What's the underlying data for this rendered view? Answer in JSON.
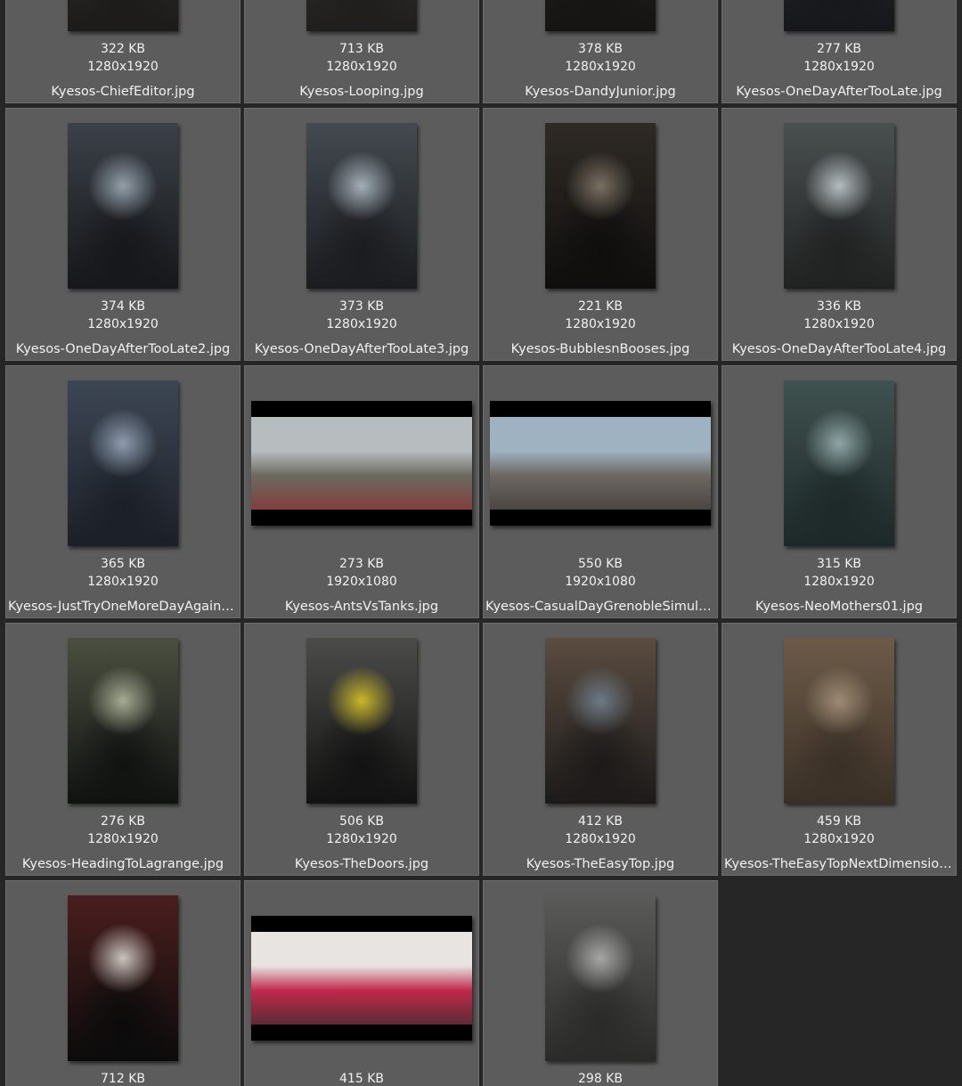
{
  "items": [
    {
      "size": "322 KB",
      "dims": "1280x1920",
      "name": "Kyesos-ChiefEditor.jpg",
      "orientation": "portrait",
      "colors": [
        "#9a9590",
        "#3a3835",
        "#1c1b1a"
      ]
    },
    {
      "size": "713 KB",
      "dims": "1280x1920",
      "name": "Kyesos-Looping.jpg",
      "orientation": "portrait",
      "colors": [
        "#8e8983",
        "#3f3d3a",
        "#1f1e1d"
      ]
    },
    {
      "size": "378 KB",
      "dims": "1280x1920",
      "name": "Kyesos-DandyJunior.jpg",
      "orientation": "portrait",
      "colors": [
        "#6e665d",
        "#2e2a26",
        "#151413"
      ]
    },
    {
      "size": "277 KB",
      "dims": "1280x1920",
      "name": "Kyesos-OneDayAfterTooLate.jpg",
      "orientation": "portrait",
      "colors": [
        "#6b7078",
        "#2a2d33",
        "#16181b"
      ]
    },
    {
      "size": "374 KB",
      "dims": "1280x1920",
      "name": "Kyesos-OneDayAfterTooLate2.jpg",
      "orientation": "portrait",
      "colors": [
        "#93a0aa",
        "#3b4148",
        "#15171a"
      ]
    },
    {
      "size": "373 KB",
      "dims": "1280x1920",
      "name": "Kyesos-OneDayAfterTooLate3.jpg",
      "orientation": "portrait",
      "colors": [
        "#a3aeb6",
        "#444a50",
        "#1a1c1f"
      ]
    },
    {
      "size": "221 KB",
      "dims": "1280x1920",
      "name": "Kyesos-BubblesnBooses.jpg",
      "orientation": "portrait",
      "colors": [
        "#7a6f62",
        "#2f2a25",
        "#0f0e0d"
      ]
    },
    {
      "size": "336 KB",
      "dims": "1280x1920",
      "name": "Kyesos-OneDayAfterTooLate4.jpg",
      "orientation": "portrait",
      "colors": [
        "#b4bcc0",
        "#4a4f50",
        "#1f2221"
      ]
    },
    {
      "size": "365 KB",
      "dims": "1280x1920",
      "name": "Kyesos-JustTryOneMoreDayAgain.jpg",
      "orientation": "portrait",
      "colors": [
        "#8e9cae",
        "#3d4654",
        "#1b1f27"
      ]
    },
    {
      "size": "273 KB",
      "dims": "1920x1080",
      "name": "Kyesos-AntsVsTanks.jpg",
      "orientation": "landscape",
      "colors": [
        "#b7bdbf",
        "#6b6a5f",
        "#8c2a2e"
      ]
    },
    {
      "size": "550 KB",
      "dims": "1920x1080",
      "name": "Kyesos-CasualDayGrenobleSimulation.jpg",
      "orientation": "landscape",
      "colors": [
        "#9fb2c2",
        "#6c6761",
        "#3a3634"
      ]
    },
    {
      "size": "315 KB",
      "dims": "1280x1920",
      "name": "Kyesos-NeoMothers01.jpg",
      "orientation": "portrait",
      "colors": [
        "#8fa6a6",
        "#3f5150",
        "#1d2828"
      ]
    },
    {
      "size": "276 KB",
      "dims": "1280x1920",
      "name": "Kyesos-HeadingToLagrange.jpg",
      "orientation": "portrait",
      "colors": [
        "#a4aa92",
        "#4a4f40",
        "#101210"
      ]
    },
    {
      "size": "506 KB",
      "dims": "1280x1920",
      "name": "Kyesos-TheDoors.jpg",
      "orientation": "portrait",
      "colors": [
        "#c9b72a",
        "#4b4b48",
        "#121212"
      ]
    },
    {
      "size": "412 KB",
      "dims": "1280x1920",
      "name": "Kyesos-TheEasyTop.jpg",
      "orientation": "portrait",
      "colors": [
        "#6b7a86",
        "#5a4c40",
        "#1c1a19"
      ]
    },
    {
      "size": "459 KB",
      "dims": "1280x1920",
      "name": "Kyesos-TheEasyTopNextDimension.jpg",
      "orientation": "portrait",
      "colors": [
        "#9c8a74",
        "#6d5b48",
        "#3a3026"
      ]
    },
    {
      "size": "712 KB",
      "dims": "",
      "name": "",
      "orientation": "portrait",
      "colors": [
        "#c9c3bd",
        "#4a1e1e",
        "#0b0b0b"
      ]
    },
    {
      "size": "415 KB",
      "dims": "",
      "name": "",
      "orientation": "landscape",
      "colors": [
        "#e7e4e2",
        "#c0284a",
        "#2f2c2b"
      ]
    },
    {
      "size": "298 KB",
      "dims": "",
      "name": "",
      "orientation": "portrait",
      "colors": [
        "#a7a7a6",
        "#5a5a59",
        "#2a2a29"
      ]
    }
  ]
}
